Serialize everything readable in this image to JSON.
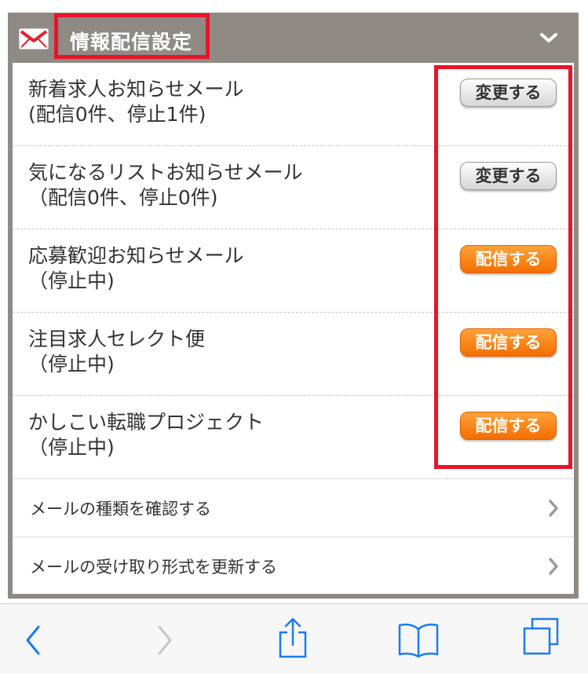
{
  "header": {
    "title": "情報配信設定",
    "mail_icon": "envelope-icon",
    "collapse_icon": "chevron-down-icon"
  },
  "rows": [
    {
      "line1": "新着求人お知らせメール",
      "line2": "(配信0件、停止1件)",
      "button": "変更する",
      "button_style": "gray"
    },
    {
      "line1": "気になるリストお知らせメール",
      "line2": "（配信0件、停止0件)",
      "button": "変更する",
      "button_style": "gray"
    },
    {
      "line1": "応募歓迎お知らせメール",
      "line2": "（停止中)",
      "button": "配信する",
      "button_style": "orange"
    },
    {
      "line1": "注目求人セレクト便",
      "line2": "（停止中)",
      "button": "配信する",
      "button_style": "orange"
    },
    {
      "line1": "かしこい転職プロジェクト",
      "line2": "（停止中)",
      "button": "配信する",
      "button_style": "orange"
    }
  ],
  "links": [
    {
      "label": "メールの種類を確認する",
      "icon": "chevron-right-icon"
    },
    {
      "label": "メールの受け取り形式を更新する",
      "icon": "chevron-right-icon"
    }
  ],
  "toolbar": {
    "back_icon": "back-arrow-icon",
    "forward_icon": "forward-arrow-icon",
    "share_icon": "share-icon",
    "bookmarks_icon": "bookmarks-icon",
    "tabs_icon": "tabs-icon"
  },
  "colors": {
    "header_bg": "#8f8a84",
    "annotation_red": "#e8142a",
    "orange_button": "#f36e00",
    "toolbar_blue": "#1a7cf0"
  }
}
